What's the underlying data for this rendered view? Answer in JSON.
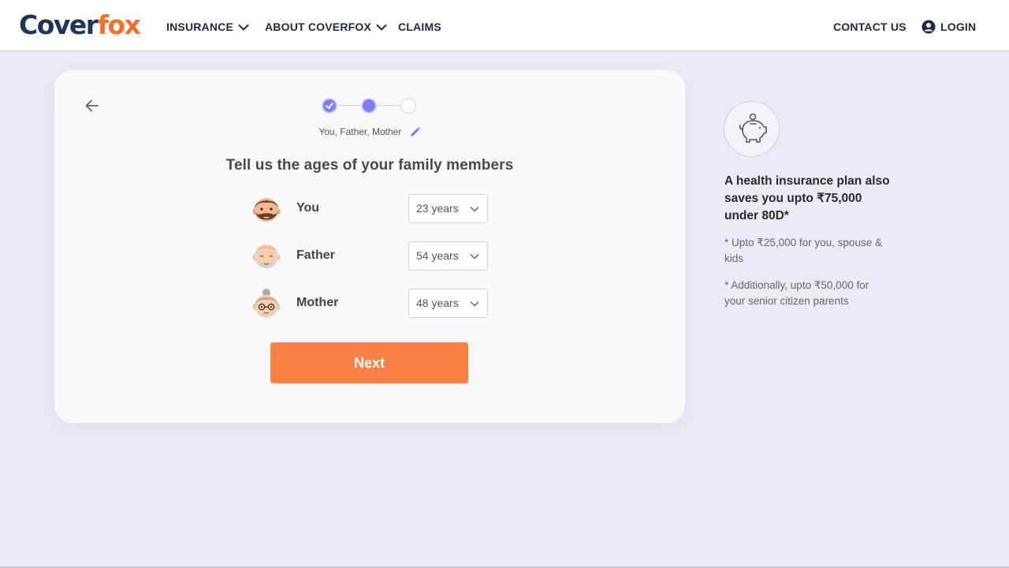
{
  "header": {
    "logo_part1": "Cover",
    "logo_part2": "fox",
    "nav": {
      "insurance": "INSURANCE",
      "about": "ABOUT COVERFOX",
      "claims": "CLAIMS",
      "contact": "CONTACT US",
      "login": "LOGIN"
    }
  },
  "card": {
    "members_summary": "You, Father, Mother",
    "title": "Tell us the ages of your family members",
    "members": [
      {
        "label": "You",
        "age": "23 years",
        "avatar": "young-man-avatar-icon"
      },
      {
        "label": "Father",
        "age": "54 years",
        "avatar": "old-man-avatar-icon"
      },
      {
        "label": "Mother",
        "age": "48 years",
        "avatar": "old-woman-avatar-icon"
      }
    ],
    "next_label": "Next",
    "stepper": {
      "steps": 3,
      "current": 2
    }
  },
  "side": {
    "icon": "piggy-bank-icon",
    "heading": "A health insurance plan also saves you upto ₹75,000 under 80D*",
    "note1": "* Upto ₹25,000 for you, spouse & kids",
    "note2": "* Additionally, upto ₹50,000 for your senior citizen parents"
  },
  "colors": {
    "accent": "#7b7ff0",
    "cta": "#f98244",
    "brand_orange": "#f5702b",
    "brand_navy": "#1d3557",
    "background": "#ebebf5"
  }
}
